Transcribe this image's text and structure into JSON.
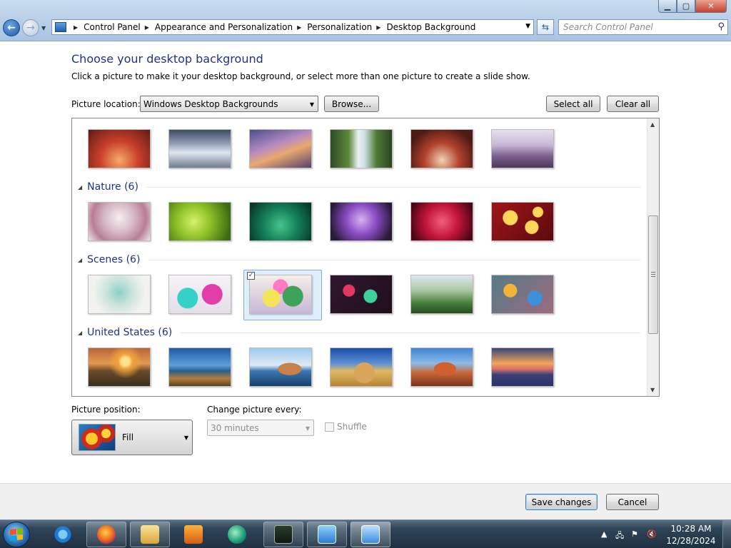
{
  "address": {
    "crumbs": [
      "Control Panel",
      "Appearance and Personalization",
      "Personalization",
      "Desktop Background"
    ],
    "search_placeholder": "Search Control Panel"
  },
  "content": {
    "heading": "Choose your desktop background",
    "subtext": "Click a picture to make it your desktop background, or select more than one picture to create a slide show.",
    "picture_location_label": "Picture location:",
    "picture_location_value": "Windows Desktop Backgrounds",
    "browse_label": "Browse...",
    "select_all_label": "Select all",
    "clear_all_label": "Clear all"
  },
  "gallery": {
    "groups": [
      {
        "title": "Nature (6)"
      },
      {
        "title": "Scenes (6)"
      },
      {
        "title": "United States (6)"
      }
    ],
    "selected_image": "Scenes image 3"
  },
  "options": {
    "position_label": "Picture position:",
    "position_value": "Fill",
    "interval_label": "Change picture every:",
    "interval_value": "30 minutes",
    "shuffle_label": "Shuffle",
    "shuffle_checked": false
  },
  "footer": {
    "save_label": "Save changes",
    "cancel_label": "Cancel"
  },
  "taskbar": {
    "apps": [
      "Internet Explorer",
      "Firefox",
      "Windows Explorer",
      "Windows Media Player",
      "Windows Media Center",
      "Task Manager",
      "Remote Desktop",
      "Control Panel"
    ],
    "time": "10:28 AM",
    "date": "12/28/2024"
  },
  "colors": {
    "heading": "#1e3287",
    "selection": "#dfeefb"
  }
}
